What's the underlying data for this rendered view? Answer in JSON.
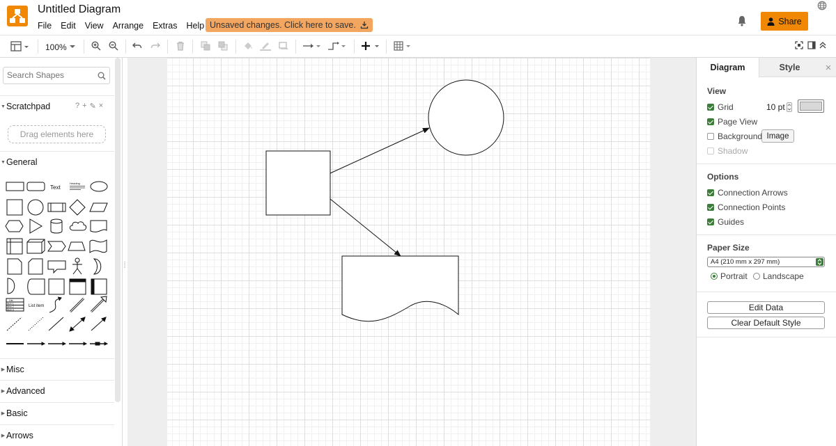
{
  "header": {
    "title": "Untitled Diagram",
    "menus": [
      "File",
      "Edit",
      "View",
      "Arrange",
      "Extras",
      "Help"
    ],
    "unsaved_notice": "Unsaved changes. Click here to save.",
    "share_label": "Share",
    "accent_color": "#f08705"
  },
  "toolbar": {
    "zoom_label": "100%"
  },
  "left_panel": {
    "search_placeholder": "Search Shapes",
    "scratchpad_label": "Scratchpad",
    "scratchpad_tools": [
      "?",
      "+",
      "✎",
      "×"
    ],
    "drop_hint": "Drag elements here",
    "general_label": "General",
    "shape_text_label": "Text",
    "shape_heading_label": "Heading",
    "shape_list_item_label": "List item",
    "shape_list_label": "List",
    "shape_list_items": [
      "Item 1",
      "Item 2",
      "Item 3"
    ],
    "sections": [
      "Misc",
      "Advanced",
      "Basic",
      "Arrows"
    ]
  },
  "right_panel": {
    "tabs": [
      "Diagram",
      "Style"
    ],
    "view_title": "View",
    "grid_label": "Grid",
    "grid_size": "10 pt",
    "page_view_label": "Page View",
    "background_label": "Background",
    "image_button": "Image",
    "shadow_label": "Shadow",
    "options_title": "Options",
    "connection_arrows_label": "Connection Arrows",
    "connection_points_label": "Connection Points",
    "guides_label": "Guides",
    "paper_size_title": "Paper Size",
    "paper_size_value": "A4 (210 mm x 297 mm)",
    "portrait_label": "Portrait",
    "landscape_label": "Landscape",
    "edit_data_button": "Edit Data",
    "clear_style_button": "Clear Default Style",
    "check_color": "#3c7d3a"
  },
  "state": {
    "grid": true,
    "page_view": true,
    "background": false,
    "shadow": false,
    "connection_arrows": true,
    "connection_points": true,
    "guides": true,
    "orientation": "portrait"
  },
  "diagram": {
    "shapes": [
      "square",
      "circle",
      "document"
    ],
    "edges": [
      {
        "from": "square",
        "to": "circle"
      },
      {
        "from": "square",
        "to": "document"
      }
    ]
  }
}
